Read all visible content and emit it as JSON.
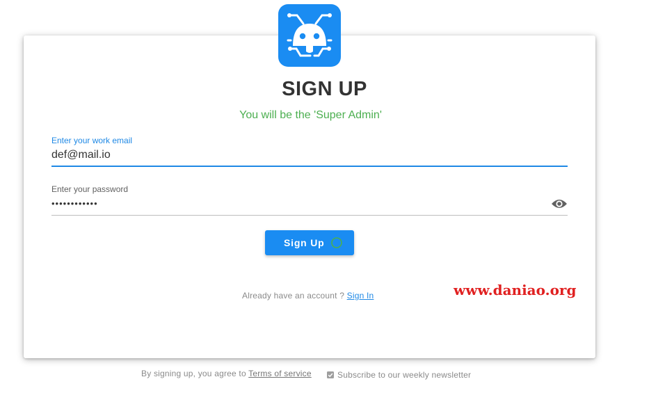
{
  "header": {
    "title": "SIGN UP",
    "subtitle": "You will be the 'Super Admin'"
  },
  "form": {
    "email_label": "Enter your work email",
    "email_value": "def@mail.io",
    "password_label": "Enter your password",
    "password_value": "••••••••••••",
    "submit_label": "Sign Up"
  },
  "signin": {
    "prompt": "Already have an account ? ",
    "link_label": "Sign In"
  },
  "watermark": "www.daniao.org",
  "footer": {
    "terms_prefix": "By signing up, you agree to ",
    "terms_link": "Terms of service",
    "newsletter_label": "Subscribe to our weekly newsletter"
  },
  "icons": {
    "logo": "robot-logo-icon",
    "password_toggle": "eye-icon",
    "loading": "spinner-icon",
    "newsletter": "checkbox-icon"
  },
  "colors": {
    "accent": "#1a8cf2",
    "focus": "#1e88e5",
    "success": "#4caf50",
    "watermark": "#e02020",
    "title": "#333333"
  }
}
